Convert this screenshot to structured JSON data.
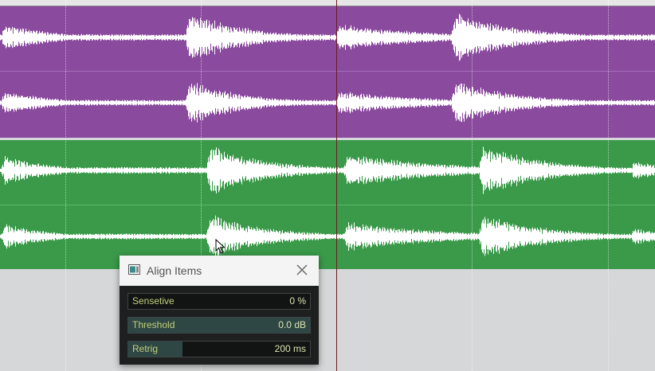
{
  "colors": {
    "purple_track": "#8a4a9e",
    "green_track": "#3a9a4a",
    "waveform": "#ffffff",
    "play_cursor": "#6b1e22",
    "dialog_bg": "#1e2020",
    "param_label": "#c3ce7a"
  },
  "dialog": {
    "title": "Align Items",
    "params": [
      {
        "label": "Sensetive",
        "value": "0 %",
        "level": 0
      },
      {
        "label": "Threshold",
        "value": "0.0 dB",
        "level": 1.0
      },
      {
        "label": "Retrig",
        "value": "200 ms",
        "level": 0.3
      }
    ]
  },
  "icons": {
    "dialog_icon": "window-icon",
    "close": "close-icon",
    "cursor": "mouse-pointer-icon"
  }
}
